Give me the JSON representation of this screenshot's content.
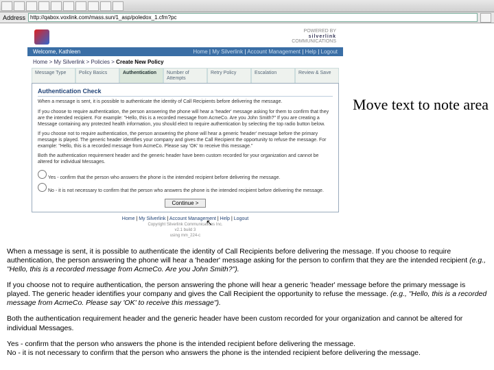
{
  "browser": {
    "address_label": "Address",
    "url": "http://qabox.voxlink.com/mass.sun/1_asp/poledox_1.cfm?pc"
  },
  "brand": {
    "powered_label": "POWERED BY",
    "name": "silverlink",
    "sub": "COMMUNICATIONS"
  },
  "welcome": {
    "greeting": "Welcome, Kathleen",
    "links": [
      "Home",
      "My Silverlink",
      "Account Management",
      "Help",
      "Logout"
    ]
  },
  "breadcrumb": {
    "path": "Home > My Silverlink > Policies >",
    "current": "Create New Policy"
  },
  "tabs": [
    {
      "label": "Message Type"
    },
    {
      "label": "Policy Basics"
    },
    {
      "label": "Authentication",
      "active": true
    },
    {
      "label": "Number of Attempts"
    },
    {
      "label": "Retry Policy"
    },
    {
      "label": "Escalation"
    },
    {
      "label": "Review & Save"
    }
  ],
  "auth": {
    "heading": "Authentication Check",
    "intro": "When a message is sent, it is possible to authenticate the identity of Call Recipients before delivering the message.",
    "p1": "If you choose to require authentication, the person answering the phone will hear a 'header' message asking for them to confirm that they are the intended recipient. For example: \"Hello, this is a recorded message from AcmeCo. Are you John Smith?\" If you are creating a Message containing any protected health information, you should elect to require authentication by selecting the top radio button below.",
    "p2": "If you choose not to require authentication, the person answering the phone will hear a generic 'header' message before the primary message is played. The generic header identifies your company and gives the Call Recipient the opportunity to refuse the message. For example: \"Hello, this is a recorded message from AcmeCo. Please say 'OK' to receive this message.\"",
    "p3": "Both the authentication requirement header and the generic header have been custom recorded for your organization and cannot be altered for individual Messages.",
    "opt_yes": "Yes - confirm that the person who answers the phone is the intended recipient before delivering the message.",
    "opt_no": "No - it is not necessary to confirm that the person who answers the phone is the intended recipient before delivering the message.",
    "continue": "Continue >"
  },
  "footer": {
    "links": [
      "Home",
      "My Silverlink",
      "Account Management",
      "Help",
      "Logout"
    ],
    "copyright": "Copyright Silverlink Communications Inc.",
    "version": "v2.1 build 3",
    "timestamp": "using mm_224-c"
  },
  "callout": "Move text to note area",
  "notes": {
    "p1a": "When a message is sent, it is possible to authenticate the identity of Call Recipients before delivering the message. If you choose to require authentication, the person answering the phone will hear a 'header' message asking for the person to confirm that they are the intended recipient ",
    "p1b": "(e.g., \"Hello, this is a recorded message from AcmeCo. Are you John Smith?\").",
    "p2a": "If you choose not to require authentication, the person answering the phone will hear a generic 'header' message before the primary message is played. The generic header identifies your company and gives the Call Recipient the opportunity to refuse the message. ",
    "p2b": "(e.g., \"Hello, this is a recorded message from AcmeCo. Please say 'OK' to receive this message\").",
    "p3": "Both the authentication requirement header and the generic header have been custom recorded for your organization and cannot be altered for individual Messages.",
    "p4": "Yes - confirm that the person who answers the phone is the intended recipient before delivering the message.",
    "p5": "No - it is not necessary to confirm that the person who answers the phone is the intended recipient before delivering the message."
  }
}
